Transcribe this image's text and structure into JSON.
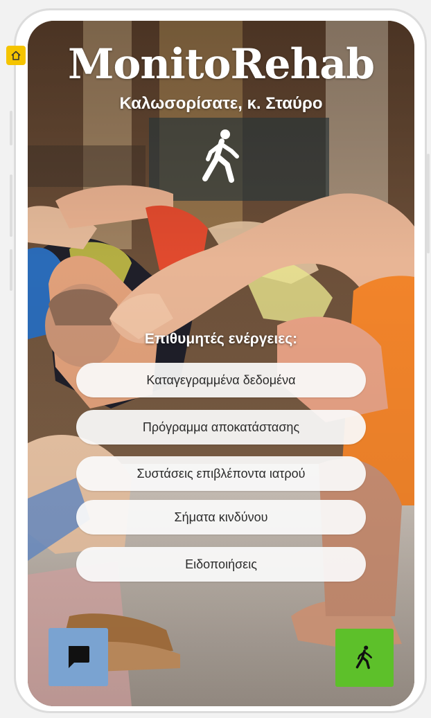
{
  "app": {
    "title": "MonitoRehab",
    "welcome": "Καλωσορίσατε, κ. Σταύρο"
  },
  "actions": {
    "heading": "Επιθυμητές ενέργειες:",
    "items": [
      {
        "label": "Καταγεγραμμένα δεδομένα"
      },
      {
        "label": "Πρόγραμμα αποκατάστασης"
      },
      {
        "label": "Συστάσεις επιβλέποντα ιατρού"
      },
      {
        "label": "Σήματα κινδύνου"
      },
      {
        "label": "Ειδοποιήσεις"
      }
    ]
  },
  "icons": {
    "home": "home-icon",
    "logo": "walking-person-icon",
    "chat": "chat-bubble-icon",
    "walk_button": "walking-person-icon"
  },
  "colors": {
    "home_badge": "#f5c400",
    "chat_button": "#7aa3d1",
    "walk_button": "#5dc02a",
    "text_on_photo": "#ffffff",
    "button_bg": "#fafafa"
  }
}
